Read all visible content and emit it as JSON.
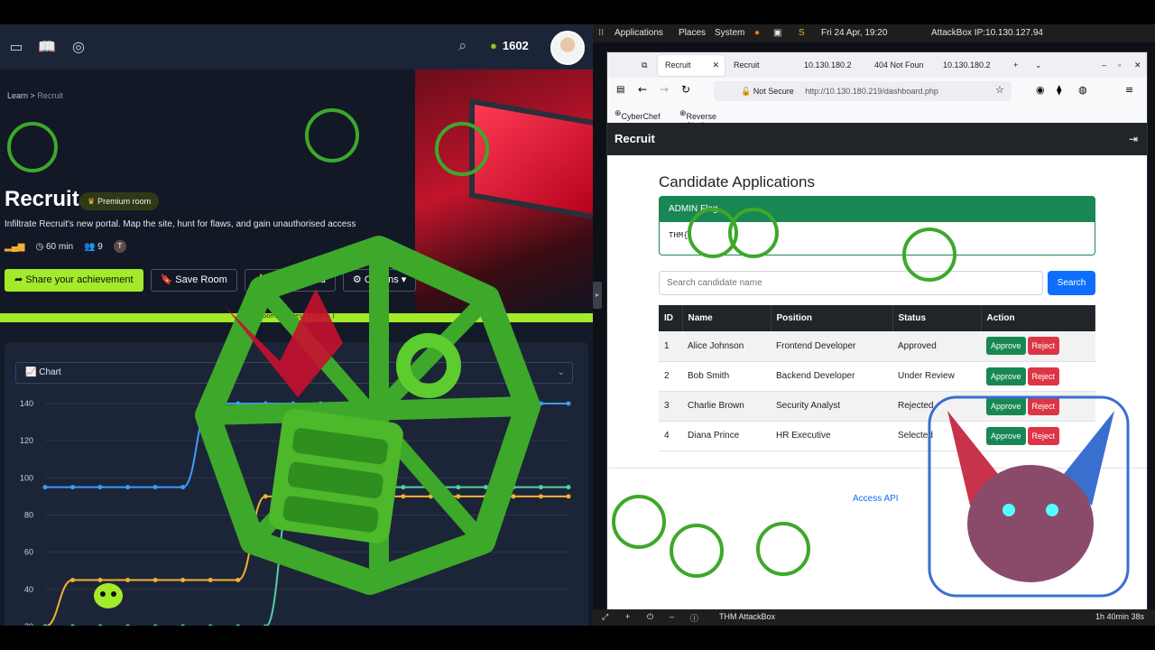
{
  "thm": {
    "points": "1602",
    "breadcrumb": {
      "learn": "Learn",
      "sep": ">",
      "current": "Recruit"
    },
    "title": "Recruit",
    "badge": "Premium room",
    "description": "Infiltrate Recruit's new portal. Map the site, hunt for flaws, and gain unauthorised access",
    "duration": "60 min",
    "users": "9",
    "avatar_letter": "T",
    "buttons": {
      "share": "Share your achievement",
      "save": "Save Room",
      "recommend": "Recommend",
      "options": "Options"
    },
    "progress_label": "Room progress ( 100% )",
    "progress": 1.0,
    "chart_select": "Chart"
  },
  "chart_data": {
    "type": "line",
    "title": "",
    "xlabel": "",
    "ylabel": "",
    "ylim": [
      20,
      140
    ],
    "yticks": [
      20,
      40,
      60,
      80,
      100,
      120,
      140
    ],
    "x": [
      0,
      1,
      2,
      3,
      4,
      5,
      6,
      7,
      8,
      9,
      10,
      11,
      12,
      13,
      14,
      15,
      16,
      17,
      18,
      19
    ],
    "series": [
      {
        "color": "#3b9cff",
        "values": [
          95,
          95,
          95,
          95,
          95,
          95,
          140,
          140,
          140,
          140,
          140,
          140,
          140,
          140,
          140,
          140,
          140,
          140,
          140,
          140
        ]
      },
      {
        "color": "#f2b134",
        "values": [
          20,
          45,
          45,
          45,
          45,
          45,
          45,
          45,
          90,
          90,
          90,
          90,
          90,
          90,
          90,
          90,
          90,
          90,
          90,
          90
        ]
      },
      {
        "color": "#4fd1a5",
        "values": [
          20,
          20,
          20,
          20,
          20,
          20,
          20,
          20,
          20,
          95,
          95,
          95,
          95,
          95,
          95,
          95,
          95,
          95,
          95,
          95
        ]
      }
    ]
  },
  "attackbox": {
    "topbar": {
      "applications": "Applications",
      "places": "Places",
      "system": "System",
      "datetime": "Fri 24 Apr, 19:20",
      "ip": "AttackBox IP:10.130.127.94"
    },
    "tabs": [
      "Recruit",
      "Recruit",
      "10.130.180.2",
      "404 Not Foun",
      "10.130.180.2"
    ],
    "url": "http://10.130.180.219/dashboard.php",
    "not_secure": "Not Secure",
    "bookmarks": [
      "CyberChef",
      "Reverse Shell Generator"
    ],
    "site_title": "Recruit",
    "heading": "Candidate Applications",
    "flag_head": "ADMIN Flag",
    "flag_body": "THM{",
    "search_placeholder": "Search candidate name",
    "search_btn": "Search",
    "columns": [
      "ID",
      "Name",
      "Position",
      "Status",
      "Action"
    ],
    "rows": [
      {
        "id": "1",
        "name": "Alice Johnson",
        "position": "Frontend Developer",
        "status": "Approved"
      },
      {
        "id": "2",
        "name": "Bob Smith",
        "position": "Backend Developer",
        "status": "Under Review"
      },
      {
        "id": "3",
        "name": "Charlie Brown",
        "position": "Security Analyst",
        "status": "Rejected"
      },
      {
        "id": "4",
        "name": "Diana Prince",
        "position": "HR Executive",
        "status": "Selected"
      }
    ],
    "approve": "Approve",
    "reject": "Reject",
    "access_api": "Access API",
    "bottom": {
      "label": "THM AttackBox",
      "timer": "1h 40min 38s"
    }
  }
}
